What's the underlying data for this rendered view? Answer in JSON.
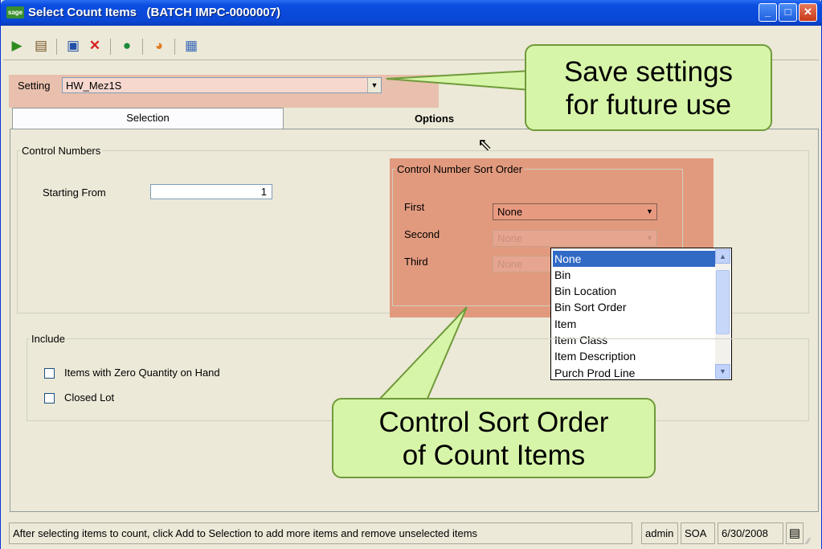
{
  "window": {
    "title": "Select Count Items   (BATCH IMPC-0000007)",
    "app_icon_label": "sage",
    "controls": {
      "minimize": "_",
      "maximize": "□",
      "close": "✕"
    }
  },
  "toolbar": {
    "icons": [
      "play-icon",
      "export-icon",
      "save-icon",
      "delete-icon",
      "help-icon",
      "color-icon",
      "calendar-icon"
    ]
  },
  "setting": {
    "label": "Setting",
    "value": "HW_Mez1S"
  },
  "tabs": {
    "selection": "Selection",
    "options": "Options"
  },
  "control_numbers": {
    "legend": "Control Numbers",
    "starting_from_label": "Starting From",
    "starting_from_value": "1"
  },
  "sort_order": {
    "legend": "Control Number Sort Order",
    "first_label": "First",
    "first_value": "None",
    "second_label": "Second",
    "second_value": "None",
    "third_label": "Third",
    "third_value": "None"
  },
  "dropdown": {
    "options": [
      "None",
      "Bin",
      "Bin Location",
      "Bin Sort Order",
      "Item",
      "Item Class",
      "Item Description",
      "Purch Prod Line"
    ],
    "selected": "None"
  },
  "include": {
    "legend": "Include",
    "items": [
      {
        "label": "Items with Zero Quantity on Hand",
        "checked": false
      },
      {
        "label": "Closed Lot",
        "checked": false
      }
    ]
  },
  "status": {
    "message": "After selecting items to count, click Add to Selection to add more items and remove unselected items",
    "user": "admin",
    "company": "SOA",
    "date": "6/30/2008"
  },
  "callouts": {
    "save_line1": "Save settings",
    "save_line2": "for future use",
    "sort_line1": "Control Sort Order",
    "sort_line2": "of Count Items"
  },
  "colors": {
    "highlight": "#e08c6e",
    "callout_fill": "#d7f5a8",
    "callout_border": "#6f9a3a",
    "titlebar": "#0a4ee0"
  }
}
